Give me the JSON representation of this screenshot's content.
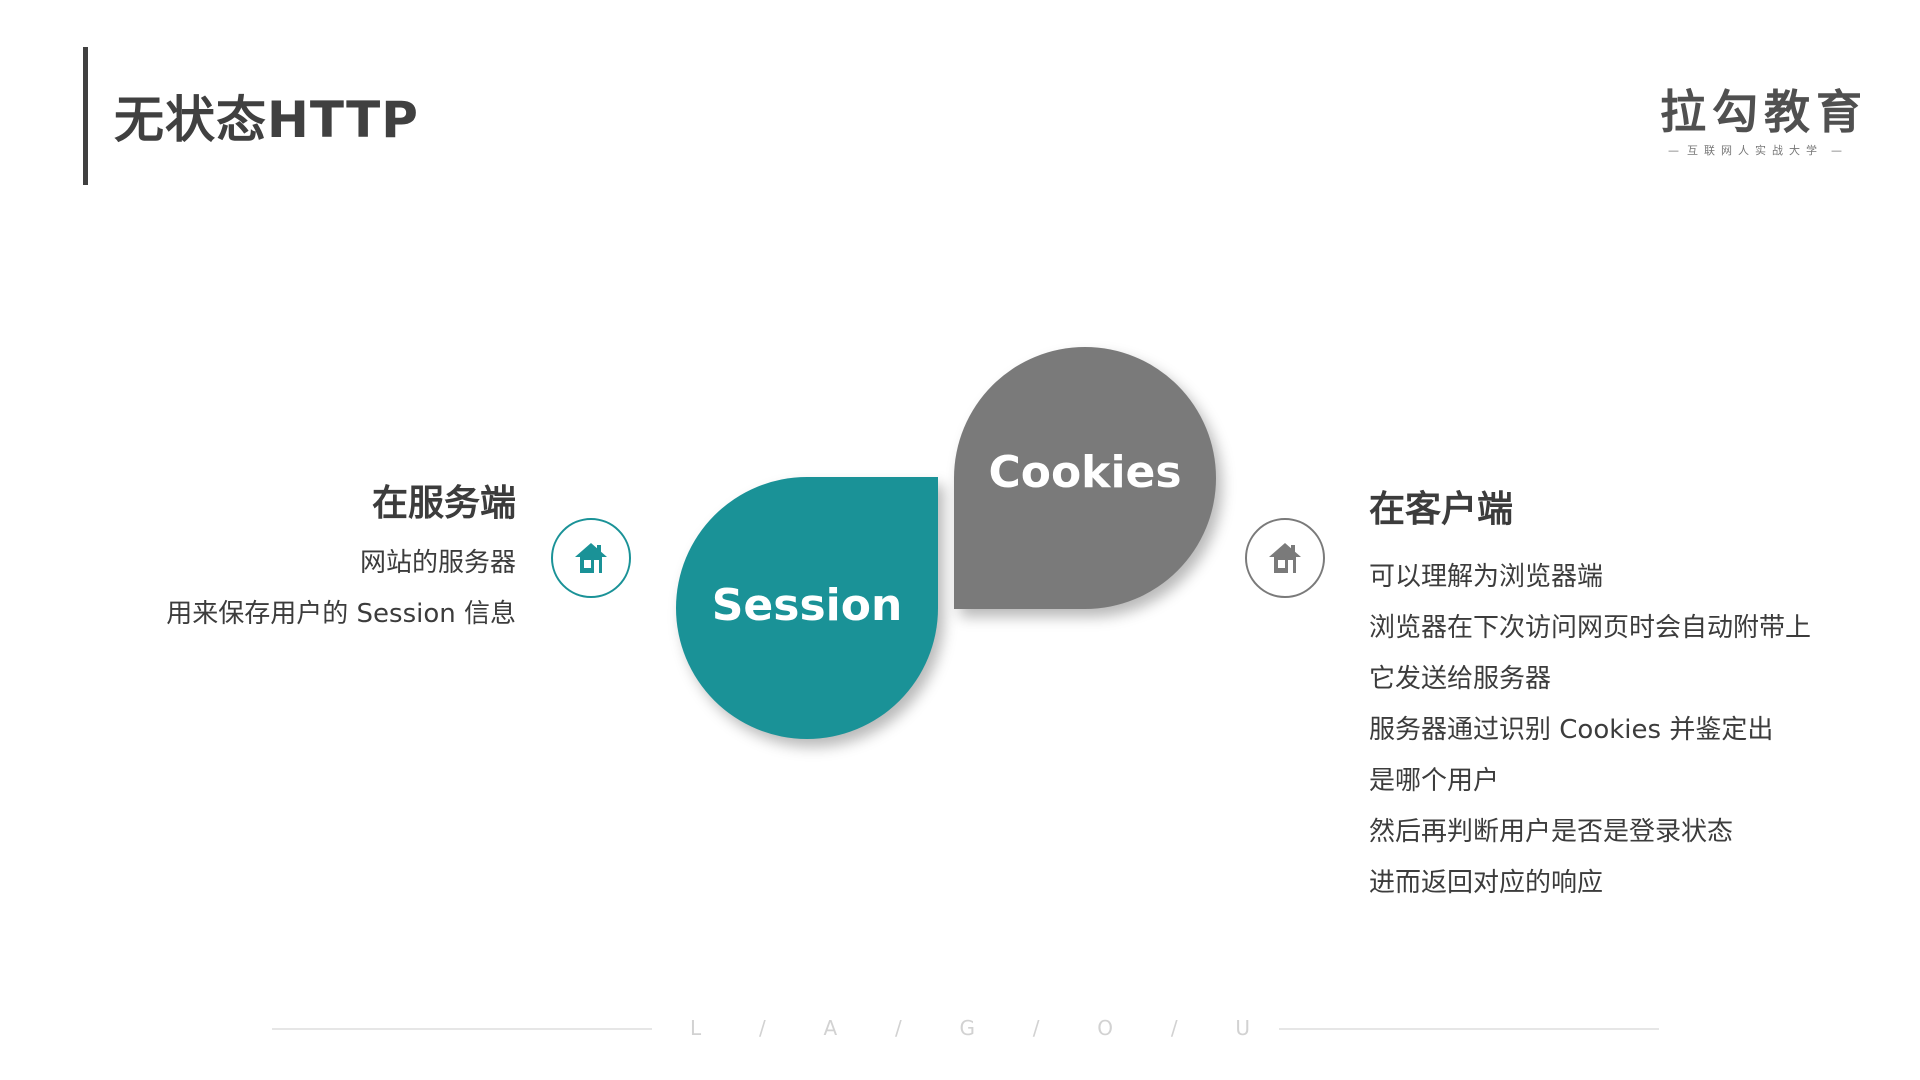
{
  "header": {
    "title": "无状态HTTP"
  },
  "logo": {
    "name": "拉勾教育",
    "tagline": "互联网人实战大学",
    "dash": "—"
  },
  "server_side": {
    "heading": "在服务端",
    "lines": [
      "网站的服务器",
      "用来保存用户的 Session 信息"
    ],
    "icon": "home-icon",
    "accent_color": "#1a9297"
  },
  "client_side": {
    "heading": "在客户端",
    "lines": [
      "可以理解为浏览器端",
      "浏览器在下次访问网页时会自动附带上",
      "它发送给服务器",
      "服务器通过识别 Cookies 并鉴定出",
      "是哪个用户",
      "然后再判断用户是否是登录状态",
      "进而返回对应的响应"
    ],
    "icon": "home-icon",
    "accent_color": "#7a7a7a"
  },
  "petals": {
    "session_label": "Session",
    "cookies_label": "Cookies",
    "session_color": "#1a9297",
    "cookies_color": "#7a7a7a"
  },
  "footer": {
    "letters": [
      "L",
      "/",
      "A",
      "/",
      "G",
      "/",
      "O",
      "/",
      "U"
    ]
  }
}
